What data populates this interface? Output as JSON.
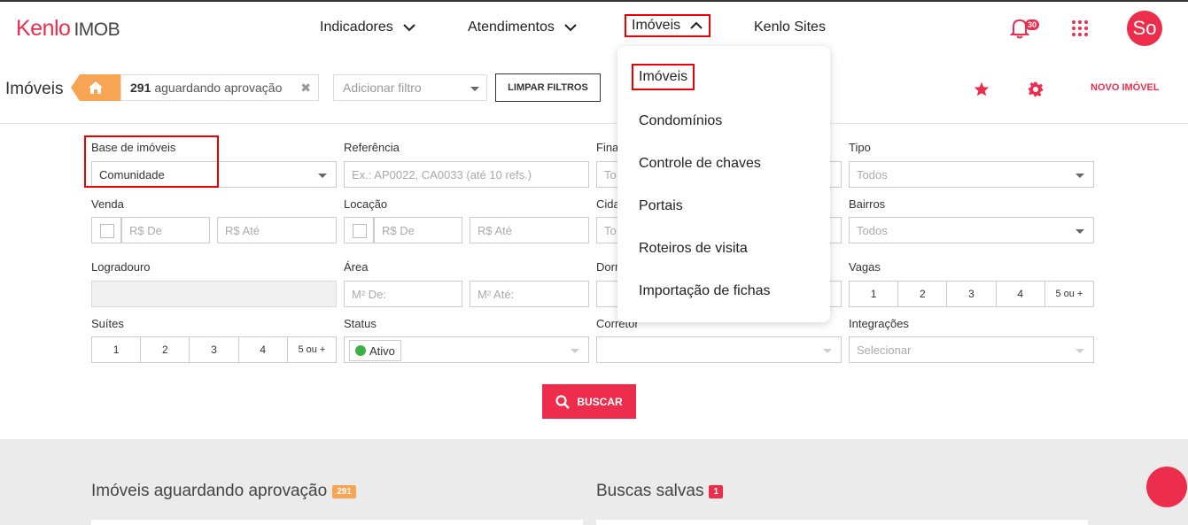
{
  "brand": {
    "logo_main": "Kenlo",
    "logo_sub": "IMOB"
  },
  "nav": {
    "items": [
      "Indicadores",
      "Atendimentos",
      "Imóveis",
      "Kenlo Sites"
    ]
  },
  "header": {
    "notifications_count": "30",
    "avatar_initials": "So"
  },
  "subbar": {
    "title": "Imóveis",
    "pending_count": "291",
    "pending_label": "aguardando aprovação",
    "add_filter_placeholder": "Adicionar filtro",
    "clear_filters": "LIMPAR FILTROS",
    "new_property": "NOVO IMÓVEL"
  },
  "form": {
    "base_label": "Base de imóveis",
    "base_value": "Comunidade",
    "ref_label": "Referência",
    "ref_placeholder": "Ex.: AP0022, CA0033 (até 10 refs.)",
    "fin_label": "Fina",
    "fin_value": "To",
    "tipo_label": "Tipo",
    "tipo_value": "Todos",
    "venda_label": "Venda",
    "venda_from": "R$ De",
    "venda_to": "R$ Até",
    "locacao_label": "Locação",
    "locacao_from": "R$ De",
    "locacao_to": "R$ Até",
    "cidade_label": "Cida",
    "cidade_value": "To",
    "bairros_label": "Bairros",
    "bairros_value": "Todos",
    "logradouro_label": "Logradouro",
    "area_label": "Área",
    "area_from": "M² De:",
    "area_to": "M² Até:",
    "dorm_label": "Dorm",
    "vagas_label": "Vagas",
    "vagas_options": [
      "1",
      "2",
      "3",
      "4",
      "5 ou +"
    ],
    "suites_label": "Suítes",
    "suites_options": [
      "1",
      "2",
      "3",
      "4",
      "5 ou +"
    ],
    "status_label": "Status",
    "status_value": "Ativo",
    "corretor_label": "Corretor",
    "integracoes_label": "Integrações",
    "integracoes_value": "Selecionar",
    "search_button": "BUSCAR"
  },
  "dropdown": {
    "items": [
      "Imóveis",
      "Condomínios",
      "Controle de chaves",
      "Portais",
      "Roteiros de visita",
      "Importação de fichas"
    ]
  },
  "sections": {
    "pending_title": "Imóveis aguardando aprovação",
    "pending_badge": "291",
    "saved_title": "Buscas salvas",
    "saved_badge": "1"
  },
  "colors": {
    "brand": "#ec2e4c",
    "pending_badge": "#f7a552",
    "status_active": "#3cb043"
  }
}
